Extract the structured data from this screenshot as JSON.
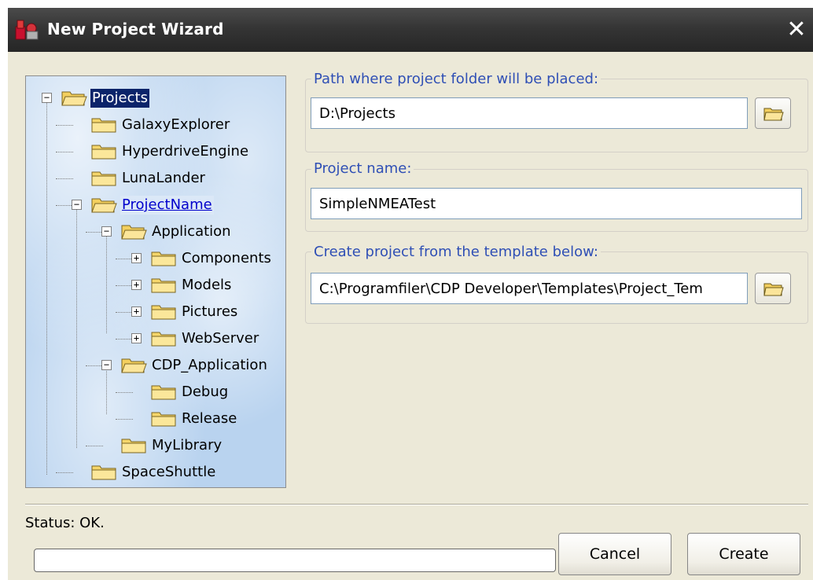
{
  "window": {
    "title": "New Project Wizard",
    "close_label": "✕"
  },
  "tree": {
    "items": [
      {
        "label": "Projects",
        "state": "selected",
        "expander": "−"
      },
      {
        "label": "GalaxyExplorer"
      },
      {
        "label": "HyperdriveEngine"
      },
      {
        "label": "LunaLander"
      },
      {
        "label": "ProjectName",
        "state": "current",
        "expander": "−"
      },
      {
        "label": "Application",
        "expander": "−"
      },
      {
        "label": "Components",
        "expander": "+"
      },
      {
        "label": "Models",
        "expander": "+"
      },
      {
        "label": "Pictures",
        "expander": "+"
      },
      {
        "label": "WebServer",
        "expander": "+"
      },
      {
        "label": "CDP_Application",
        "expander": "−"
      },
      {
        "label": "Debug"
      },
      {
        "label": "Release"
      },
      {
        "label": "MyLibrary"
      },
      {
        "label": "SpaceShuttle"
      }
    ]
  },
  "path_group": {
    "label": "Path where project folder will be placed:",
    "value": "D:\\Projects"
  },
  "name_group": {
    "label": "Project name:",
    "value": "SimpleNMEATest"
  },
  "template_group": {
    "label": "Create project from the template below:",
    "value": "C:\\Programfiler\\CDP Developer\\Templates\\Project_Tem"
  },
  "status": {
    "text": "Status: OK.",
    "progress": 0
  },
  "buttons": {
    "cancel": "Cancel",
    "create": "Create"
  },
  "colors": {
    "selection": "#0b246a",
    "group_label": "#2f4fb5",
    "dialog_bg": "#ece9d8",
    "tree_bg": "#b9d3ef"
  },
  "icons": {
    "app": "app-icon",
    "folder": "folder-icon",
    "browse": "open-folder-icon"
  }
}
